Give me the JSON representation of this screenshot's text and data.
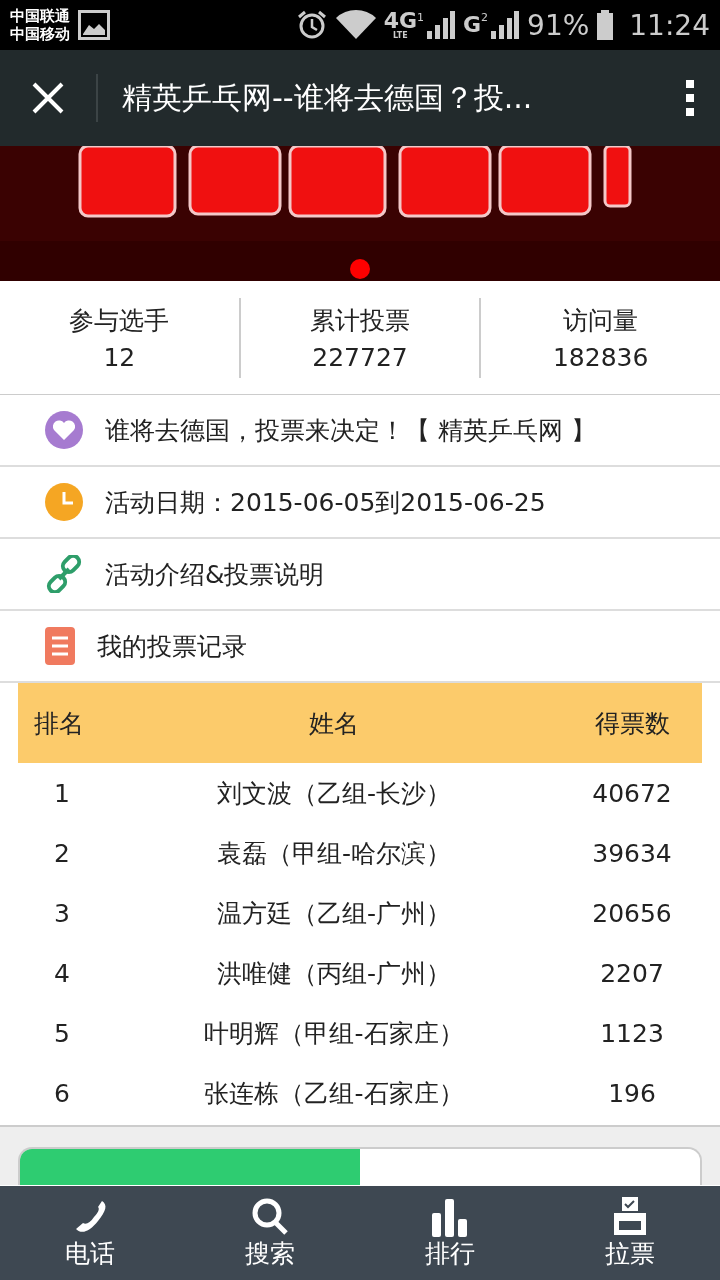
{
  "status_bar": {
    "carriers": [
      "中国联通",
      "中国移动"
    ],
    "networks": [
      {
        "label": "4G",
        "sub": "LTE",
        "sim": "1"
      },
      {
        "label": "G",
        "sim": "2"
      }
    ],
    "battery": "91%",
    "time": "11:24"
  },
  "title_bar": {
    "title": "精英乒乓网--谁将去德国？投..."
  },
  "banner": {
    "kind": "picture",
    "dots": [
      {
        "selected": true
      }
    ]
  },
  "stats": [
    {
      "label": "参与选手",
      "value": "12"
    },
    {
      "label": "累计投票",
      "value": "227727"
    },
    {
      "label": "访问量",
      "value": "182836"
    }
  ],
  "info_rows": [
    {
      "kind": "heart",
      "text": "谁将去德国，投票来决定！【 精英乒乓网 】"
    },
    {
      "kind": "clock",
      "text": "活动日期：2015-06-05到2015-06-25"
    },
    {
      "kind": "link",
      "text": "活动介绍&投票说明"
    },
    {
      "kind": "record",
      "text": "我的投票记录"
    }
  ],
  "table": {
    "columns": [
      "排名",
      "姓名",
      "得票数"
    ],
    "rows": [
      [
        "1",
        "刘文波（乙组-长沙）",
        "40672"
      ],
      [
        "2",
        "袁磊（甲组-哈尔滨）",
        "39634"
      ],
      [
        "3",
        "温方廷（乙组-广州）",
        "20656"
      ],
      [
        "4",
        "洪唯健（丙组-广州）",
        "2207"
      ],
      [
        "5",
        "叶明辉（甲组-石家庄）",
        "1123"
      ],
      [
        "6",
        "张连栋（乙组-石家庄）",
        "196"
      ]
    ]
  },
  "tabs": [
    {
      "selected": true
    },
    {
      "selected": false
    }
  ],
  "bottom_nav": [
    {
      "kind": "phone",
      "label": "电话"
    },
    {
      "kind": "search",
      "label": "搜索"
    },
    {
      "kind": "rank",
      "label": "排行"
    },
    {
      "kind": "vote",
      "label": "拉票"
    }
  ]
}
